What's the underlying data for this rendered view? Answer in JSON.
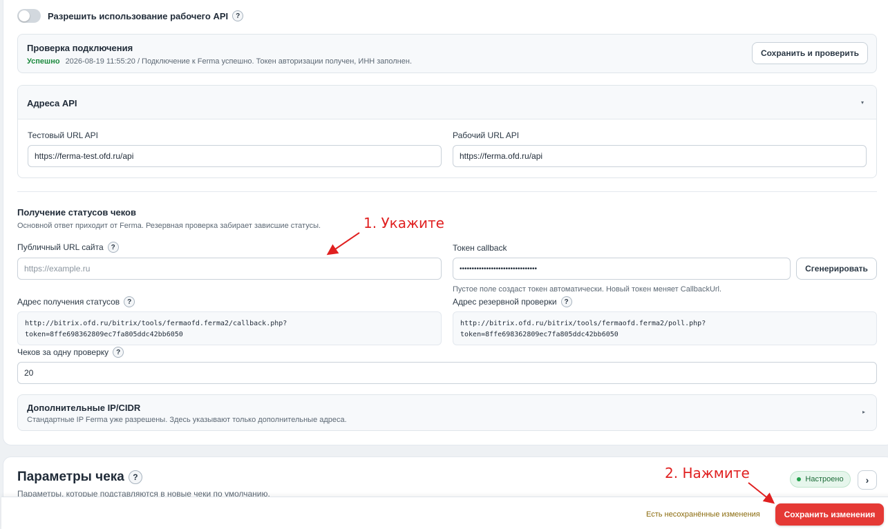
{
  "api_toggle": {
    "label": "Разрешить использование рабочего API",
    "help": "?"
  },
  "connection": {
    "title": "Проверка подключения",
    "status": "Успешно",
    "details": "2026-08-19 11:55:20 / Подключение к Ferma успешно. Токен авторизации получен, ИНН заполнен.",
    "button": "Сохранить и проверить"
  },
  "api_addresses": {
    "title": "Адреса API",
    "caret": "▾",
    "test_label": "Тестовый URL API",
    "test_value": "https://ferma-test.ofd.ru/api",
    "prod_label": "Рабочий URL API",
    "prod_value": "https://ferma.ofd.ru/api"
  },
  "statuses": {
    "title": "Получение статусов чеков",
    "subtitle": "Основной ответ приходит от Ferma. Резервная проверка забирает зависшие статусы.",
    "public_url_label": "Публичный URL сайта",
    "public_url_placeholder": "https://example.ru",
    "token_label": "Токен callback",
    "token_value": "••••••••••••••••••••••••••••••••",
    "generate_button": "Сгенерировать",
    "token_hint": "Пустое поле создаст токен автоматически. Новый токен меняет CallbackUrl.",
    "callback_label": "Адрес получения статусов",
    "callback_line1": "http://bitrix.ofd.ru/bitrix/tools/fermaofd.ferma2/callback.php?",
    "callback_line2": "token=8ffe698362809ec7fa805ddc42bb6050",
    "poll_label": "Адрес резервной проверки",
    "poll_line1": "http://bitrix.ofd.ru/bitrix/tools/fermaofd.ferma2/poll.php?",
    "poll_line2": "token=8ffe698362809ec7fa805ddc42bb6050",
    "batch_label": "Чеков за одну проверку",
    "batch_value": "20",
    "help": "?"
  },
  "extra_ip": {
    "title": "Дополнительные IP/CIDR",
    "subtitle": "Стандартные IP Ferma уже разрешены. Здесь указывают только дополнительные адреса.",
    "caret": "▸"
  },
  "receipt_params": {
    "title": "Параметры чека",
    "subtitle": "Параметры, которые подставляются в новые чеки по умолчанию.",
    "badge": "Настроено",
    "chevron": "›"
  },
  "save_bar": {
    "unsaved": "Есть несохранённые изменения",
    "save_button": "Сохранить изменения"
  },
  "annotations": {
    "step1": "1. Укажите",
    "step2": "2. Нажмите",
    "color": "#e02020"
  }
}
